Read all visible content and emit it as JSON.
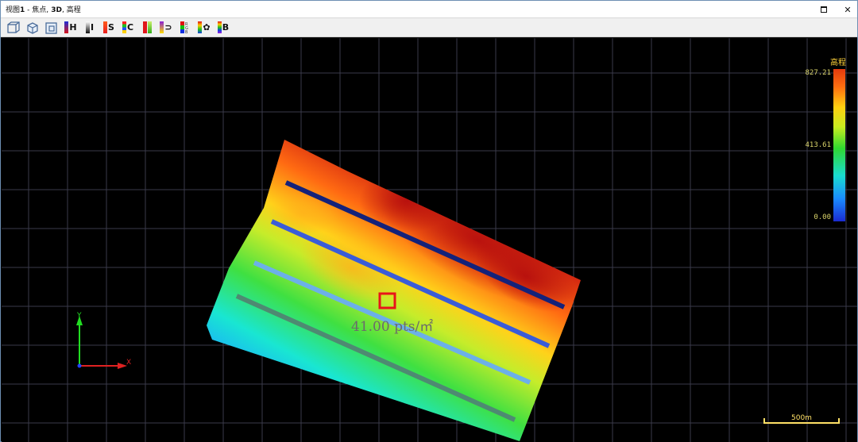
{
  "window": {
    "title_prefix": "视图",
    "title_num": "1",
    "title_mid": " - 焦点,",
    "title_mode": " 3D",
    "title_suffix": ", 高程",
    "restore_label": "",
    "close_label": "✕"
  },
  "toolbar": {
    "buttons": [
      {
        "name": "view-cube-front",
        "letter": ""
      },
      {
        "name": "view-cube-iso",
        "letter": ""
      },
      {
        "name": "view-cube-top",
        "letter": ""
      },
      {
        "name": "color-height",
        "letter": "H"
      },
      {
        "name": "color-intensity",
        "letter": "I"
      },
      {
        "name": "color-classification",
        "letter": "S"
      },
      {
        "name": "color-class-c",
        "letter": "C"
      },
      {
        "name": "color-ramp-red-green",
        "letter": ""
      },
      {
        "name": "color-return",
        "letter": "⊃"
      },
      {
        "name": "color-rgb",
        "letter": ""
      },
      {
        "name": "settings",
        "letter": "✿"
      },
      {
        "name": "color-b",
        "letter": "B"
      }
    ]
  },
  "colorbar": {
    "title": "高程",
    "max": "827.21",
    "mid": "413.61",
    "min": "0.00"
  },
  "density_label": "41.00 pts/㎡",
  "scale_bar": "500m",
  "axes": {
    "x": "X",
    "y": "Y"
  },
  "colors": {
    "grid": "#3a3a4a",
    "colorbar_text": "#d9d36a",
    "scale": "#ffe066",
    "marker": "#e8141a"
  }
}
